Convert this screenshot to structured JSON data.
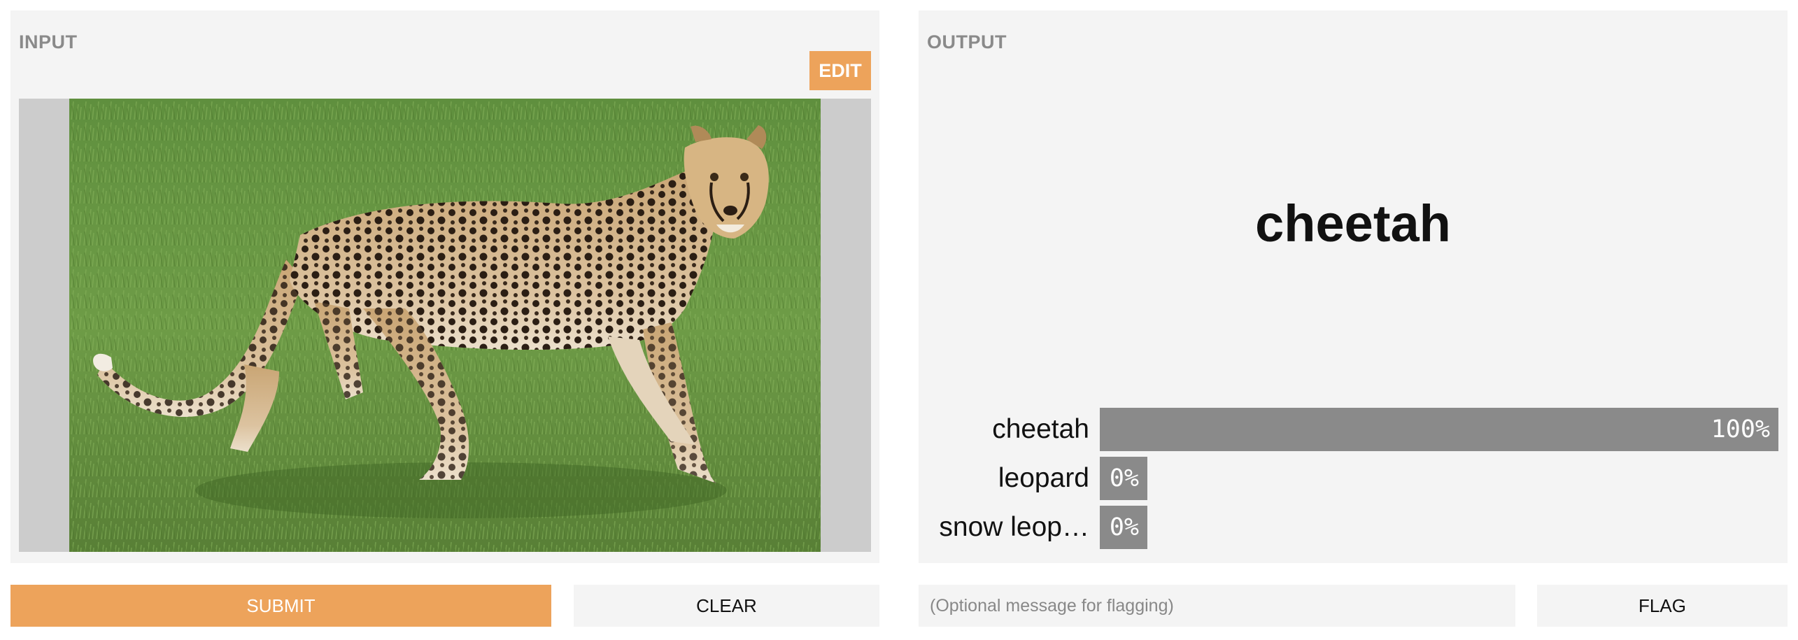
{
  "input_panel": {
    "title": "INPUT",
    "edit_label": "EDIT",
    "image_subject": "cheetah-photo"
  },
  "output_panel": {
    "title": "OUTPUT",
    "top_label": "cheetah",
    "confidences": [
      {
        "label": "cheetah",
        "value": "100%",
        "fraction": 1.0
      },
      {
        "label": "leopard",
        "value": "0%",
        "fraction": 0.0
      },
      {
        "label": "snow leop…",
        "value": "0%",
        "fraction": 0.0
      }
    ]
  },
  "actions": {
    "submit_label": "SUBMIT",
    "clear_label": "CLEAR",
    "flag_placeholder": "(Optional message for flagging)",
    "flag_label": "FLAG"
  },
  "colors": {
    "accent": "#eda35b",
    "panel_bg": "#f4f4f4",
    "bar": "#8a8a8a"
  }
}
